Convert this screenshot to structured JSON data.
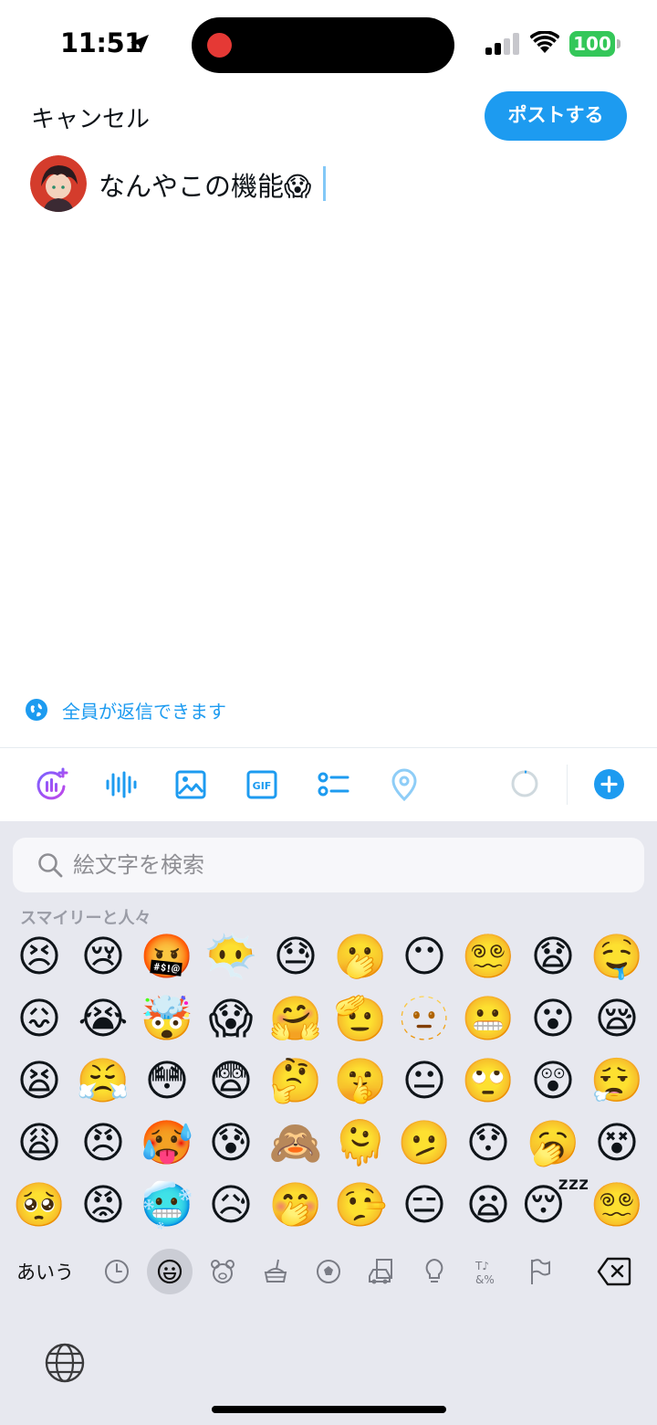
{
  "status_bar": {
    "time": "11:51",
    "battery_level": "100",
    "icons": [
      "location-arrow-icon",
      "recording-indicator",
      "cellular-signal-icon",
      "wifi-icon",
      "battery-icon"
    ]
  },
  "compose": {
    "cancel_label": "キャンセル",
    "post_label": "ポストする",
    "text": "なんやこの機能😱",
    "reply_setting_label": "全員が返信できます"
  },
  "toolbar": {
    "icons": [
      "grok-icon",
      "voice-icon",
      "image-icon",
      "gif-icon",
      "poll-icon",
      "location-icon",
      "character-counter",
      "add-post-icon"
    ]
  },
  "keyboard": {
    "search_placeholder": "絵文字を検索",
    "category_title": "スマイリーと人々",
    "emoji_rows": [
      [
        "😣",
        "😢",
        "🤬",
        "😶‍🌫️",
        "😓",
        "🫢",
        "😶",
        "😵‍💫",
        "😧",
        "🤤"
      ],
      [
        "😖",
        "😭",
        "🤯",
        "😱",
        "🤗",
        "🫡",
        "🫥",
        "😬",
        "😮",
        "😪"
      ],
      [
        "😫",
        "😤",
        "😳",
        "😨",
        "🤔",
        "🤫",
        "😐",
        "🙄",
        "😲",
        "😮‍💨"
      ],
      [
        "😩",
        "😠",
        "🥵",
        "😰",
        "🙈",
        "🫠",
        "🫤",
        "😯",
        "🥱",
        "😵"
      ],
      [
        "🥺",
        "😡",
        "🥶",
        "😥",
        "🤭",
        "🤥",
        "😑",
        "😦",
        "😴",
        "😵‍💫"
      ]
    ],
    "input_mode_label": "あいう",
    "category_icons": [
      "recent-icon",
      "smileys-icon",
      "animals-icon",
      "food-icon",
      "activity-icon",
      "travel-icon",
      "objects-icon",
      "symbols-icon",
      "flags-icon"
    ],
    "selected_category": "smileys-icon"
  },
  "colors": {
    "accent": "#1d9bf0",
    "keyboard_bg": "#e7e8ef",
    "battery_green": "#34c759"
  }
}
